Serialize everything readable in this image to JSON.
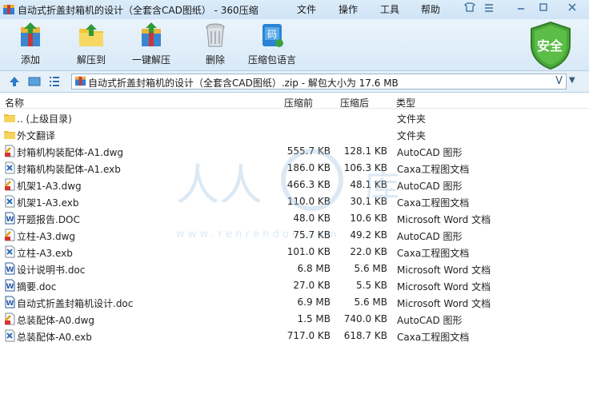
{
  "window": {
    "title": "自动式折盖封箱机的设计（全套含CAD图纸） - 360压缩",
    "menu": [
      "文件",
      "操作",
      "工具",
      "帮助"
    ]
  },
  "toolbar": {
    "add": "添加",
    "extract_to": "解压到",
    "one_click_extract": "一键解压",
    "delete": "删除",
    "archive_lang": "压缩包语言",
    "safe_badge": "安全"
  },
  "address": {
    "text": "自动式折盖封箱机的设计（全套含CAD图纸）.zip - 解包大小为 17.6 MB",
    "dropdown_indicator": "V"
  },
  "columns": {
    "name": "名称",
    "size": "压缩前",
    "compressed": "压缩后",
    "type": "类型"
  },
  "files": [
    {
      "name": ".. (上级目录)",
      "size": "",
      "compressed": "",
      "type": "文件夹",
      "icon": "folder-icon"
    },
    {
      "name": "外文翻译",
      "size": "",
      "compressed": "",
      "type": "文件夹",
      "icon": "folder-icon"
    },
    {
      "name": "封箱机构装配体-A1.dwg",
      "size": "555.7 KB",
      "compressed": "128.1 KB",
      "type": "AutoCAD 图形",
      "icon": "dwg-file-icon"
    },
    {
      "name": "封箱机构装配体-A1.exb",
      "size": "186.0 KB",
      "compressed": "106.3 KB",
      "type": "Caxa工程图文档",
      "icon": "exb-file-icon"
    },
    {
      "name": "机架1-A3.dwg",
      "size": "466.3 KB",
      "compressed": "48.1 KB",
      "type": "AutoCAD 图形",
      "icon": "dwg-file-icon"
    },
    {
      "name": "机架1-A3.exb",
      "size": "110.0 KB",
      "compressed": "30.1 KB",
      "type": "Caxa工程图文档",
      "icon": "exb-file-icon"
    },
    {
      "name": "开题报告.DOC",
      "size": "48.0 KB",
      "compressed": "10.6 KB",
      "type": "Microsoft Word 文档",
      "icon": "word-file-icon"
    },
    {
      "name": "立柱-A3.dwg",
      "size": "75.7 KB",
      "compressed": "49.2 KB",
      "type": "AutoCAD 图形",
      "icon": "dwg-file-icon"
    },
    {
      "name": "立柱-A3.exb",
      "size": "101.0 KB",
      "compressed": "22.0 KB",
      "type": "Caxa工程图文档",
      "icon": "exb-file-icon"
    },
    {
      "name": "设计说明书.doc",
      "size": "6.8 MB",
      "compressed": "5.6 MB",
      "type": "Microsoft Word 文档",
      "icon": "word-file-icon"
    },
    {
      "name": "摘要.doc",
      "size": "27.0 KB",
      "compressed": "5.5 KB",
      "type": "Microsoft Word 文档",
      "icon": "word-file-icon"
    },
    {
      "name": "自动式折盖封箱机设计.doc",
      "size": "6.9 MB",
      "compressed": "5.6 MB",
      "type": "Microsoft Word 文档",
      "icon": "word-file-icon"
    },
    {
      "name": "总装配体-A0.dwg",
      "size": "1.5 MB",
      "compressed": "740.0 KB",
      "type": "AutoCAD 图形",
      "icon": "dwg-file-icon"
    },
    {
      "name": "总装配体-A0.exb",
      "size": "717.0 KB",
      "compressed": "618.7 KB",
      "type": "Caxa工程图文档",
      "icon": "exb-file-icon"
    }
  ],
  "watermark": {
    "url_text": "w w w . r e n r e n d o c . c o m"
  }
}
